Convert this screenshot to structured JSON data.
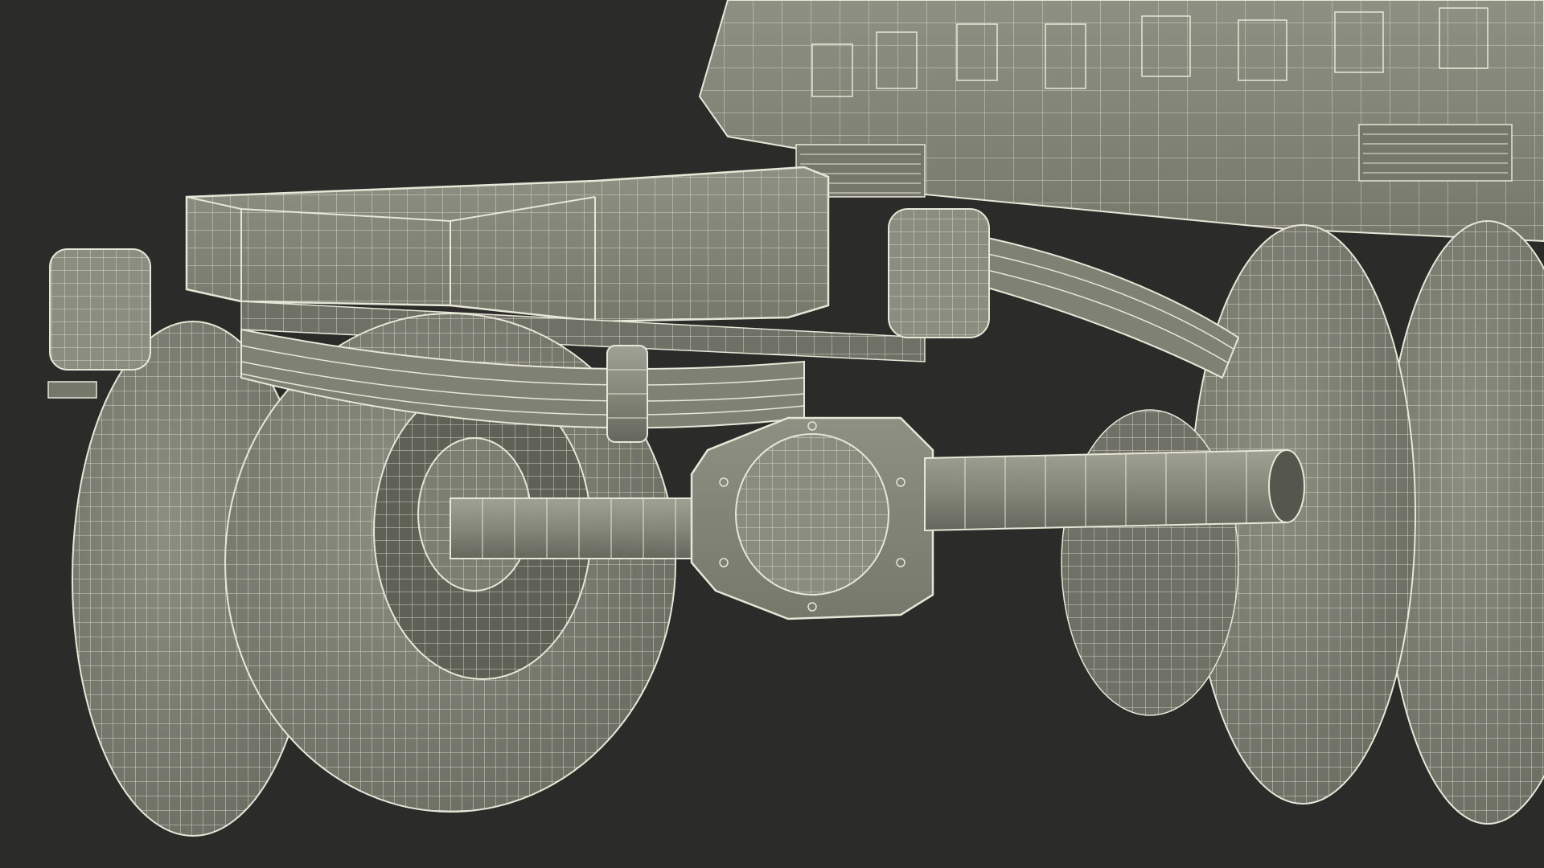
{
  "viewport": {
    "background": "#2b2b2a",
    "mesh_fill": "#85877a",
    "mesh_fill_dark": "#6f7166",
    "mesh_fill_light": "#9a9c8f",
    "wire_color": "#e6e7d6",
    "wire_color_dim": "#c9cabb",
    "render_mode": "wireframe-on-shaded"
  },
  "scene": {
    "subject": "truck-rear-axle-and-dual-wheels",
    "parts": [
      "cab-body",
      "chassis-frame-rail",
      "left-tail-light",
      "right-tail-light",
      "leaf-spring",
      "shock-absorber",
      "rear-axle-housing",
      "differential-cover",
      "axle-tube",
      "left-dual-wheels",
      "right-dual-wheels",
      "brake-drum"
    ]
  }
}
